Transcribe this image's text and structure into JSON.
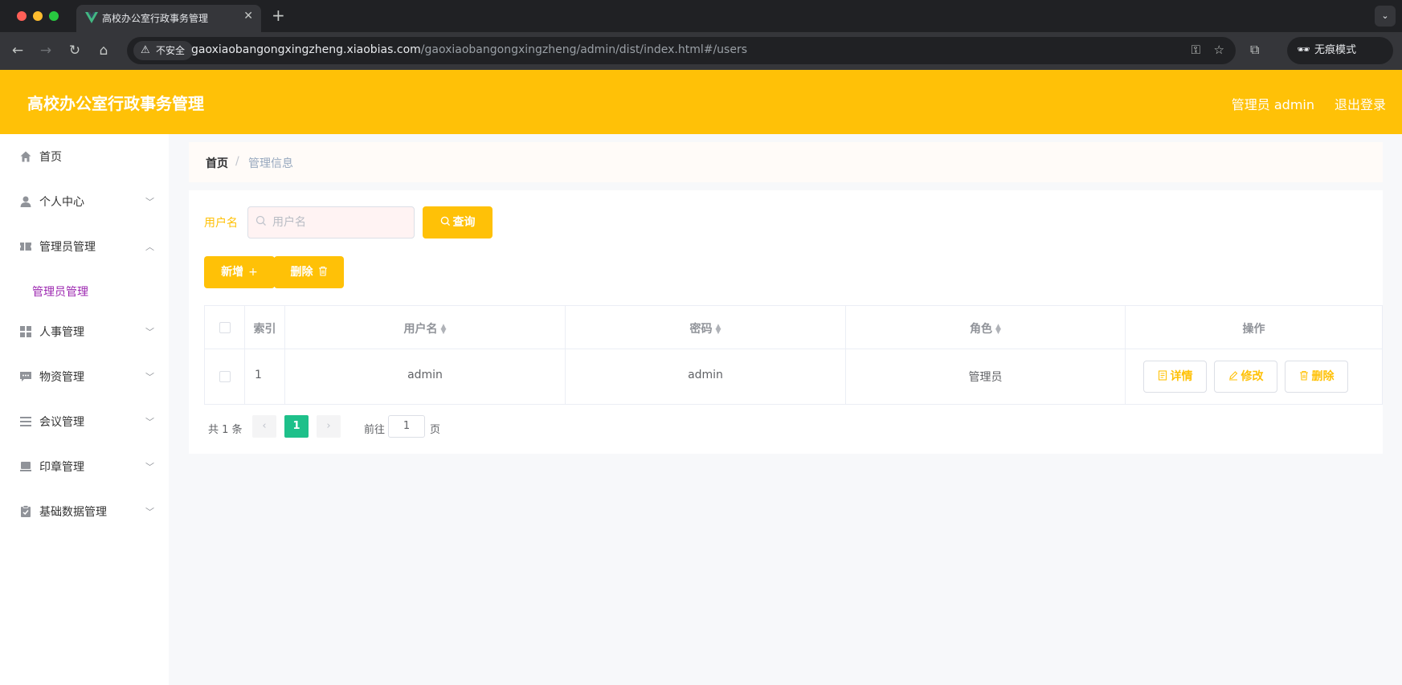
{
  "browser": {
    "tab_title": "高校办公室行政事务管理",
    "security_label": "不安全",
    "url_host": "gaoxiaobangongxingzheng.xiaobias.com",
    "url_path": "/gaoxiaobangongxingzheng/admin/dist/index.html#/users",
    "incognito_label": "无痕模式"
  },
  "header": {
    "title": "高校办公室行政事务管理",
    "user_label": "管理员 admin",
    "logout_label": "退出登录",
    "color": "#ffc107"
  },
  "sidebar": {
    "items": [
      {
        "label": "首页",
        "icon": "home-icon"
      },
      {
        "label": "个人中心",
        "icon": "user-icon"
      },
      {
        "label": "管理员管理",
        "icon": "ticket-icon"
      },
      {
        "label": "人事管理",
        "icon": "grid-icon"
      },
      {
        "label": "物资管理",
        "icon": "chat-icon"
      },
      {
        "label": "会议管理",
        "icon": "list-icon"
      },
      {
        "label": "印章管理",
        "icon": "stamp-icon"
      },
      {
        "label": "基础数据管理",
        "icon": "clipboard-icon"
      }
    ],
    "submenu_active": "管理员管理",
    "active_color": "#9c27b0"
  },
  "breadcrumb": {
    "home": "首页",
    "separator": "/",
    "current": "管理信息"
  },
  "search": {
    "label": "用户名",
    "placeholder": "用户名",
    "value": "",
    "query_label": "查询"
  },
  "toolbar": {
    "add_label": "新增",
    "delete_label": "删除"
  },
  "table": {
    "headers": {
      "index": "索引",
      "username": "用户名",
      "password": "密码",
      "role": "角色",
      "actions": "操作"
    },
    "rows": [
      {
        "index": "1",
        "username": "admin",
        "password": "admin",
        "role": "管理员"
      }
    ],
    "row_actions": {
      "detail": "详情",
      "edit": "修改",
      "delete": "删除"
    }
  },
  "pagination": {
    "total": "共 1 条",
    "current_page": "1",
    "goto_label": "前往",
    "goto_value": "1",
    "page_suffix": "页",
    "active_color": "#1ec08a"
  }
}
